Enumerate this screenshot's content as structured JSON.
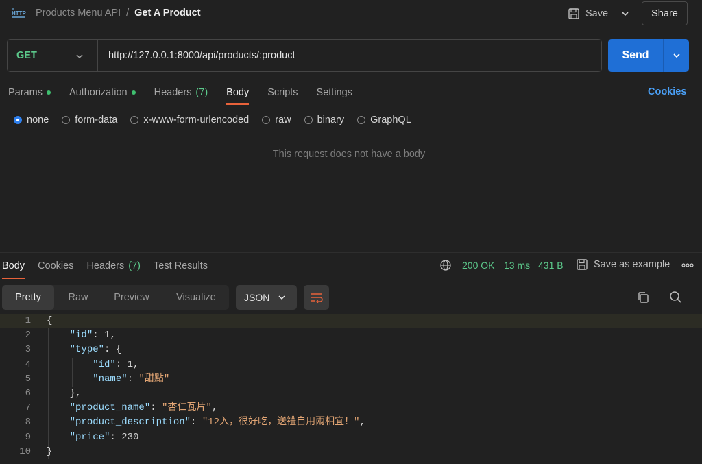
{
  "header": {
    "collection": "Products Menu API",
    "separator": "/",
    "request_name": "Get A Product",
    "save_label": "Save",
    "share_label": "Share"
  },
  "request": {
    "method": "GET",
    "url": "http://127.0.0.1:8000/api/products/:product",
    "send_label": "Send"
  },
  "req_tabs": [
    {
      "label": "Params",
      "dot": true
    },
    {
      "label": "Authorization",
      "dot": true
    },
    {
      "label": "Headers",
      "count": "(7)"
    },
    {
      "label": "Body",
      "active": true
    },
    {
      "label": "Scripts"
    },
    {
      "label": "Settings"
    }
  ],
  "cookies_label": "Cookies",
  "body_types": [
    "none",
    "form-data",
    "x-www-form-urlencoded",
    "raw",
    "binary",
    "GraphQL"
  ],
  "selected_body_type": "none",
  "no_body_text": "This request does not have a body",
  "response": {
    "tabs": [
      {
        "label": "Body",
        "active": true
      },
      {
        "label": "Cookies"
      },
      {
        "label": "Headers",
        "count": "(7)"
      },
      {
        "label": "Test Results"
      }
    ],
    "status": "200 OK",
    "time": "13 ms",
    "size": "431 B",
    "save_example_label": "Save as example",
    "formats": [
      "Pretty",
      "Raw",
      "Preview",
      "Visualize"
    ],
    "active_format": "Pretty",
    "language": "JSON"
  },
  "code_lines": [
    "{",
    "    \"id\": 1,",
    "    \"type\": {",
    "        \"id\": 1,",
    "        \"name\": \"甜點\"",
    "    },",
    "    \"product_name\": \"杏仁瓦片\",",
    "    \"product_description\": \"12入，很好吃，送禮自用兩相宜！\",",
    "    \"price\": 230",
    "}"
  ],
  "colors": {
    "accent": "#e8623a",
    "send": "#1f6fd6",
    "success": "#5cc98b",
    "link": "#4a9ff5"
  },
  "icons": [
    "http-icon",
    "save-icon",
    "chevron-down-icon",
    "globe-icon",
    "more-icon",
    "wrap-icon",
    "copy-icon",
    "search-icon"
  ]
}
